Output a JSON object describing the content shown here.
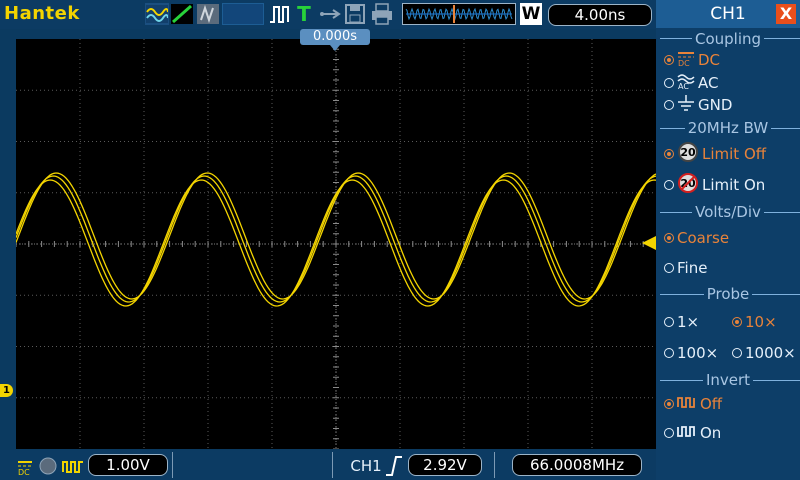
{
  "header": {
    "brand": "Hantek",
    "trigger_letter": "T",
    "time_mode": "W",
    "timebase": "4.00ns",
    "trigger_position": "0.000s"
  },
  "display": {
    "channel_marker": "1",
    "trace_color": "#f3d400",
    "grid_color": "#5a5a5a"
  },
  "footer": {
    "ch1_volts": "1.00V",
    "trigger_source": "CH1",
    "trigger_level": "2.92V",
    "frequency": "66.0008MHz"
  },
  "panel": {
    "title": "CH1",
    "close": "X",
    "coupling": {
      "title": "Coupling",
      "dc": "DC",
      "ac": "AC",
      "gnd": "GND"
    },
    "bw": {
      "title": "20MHz BW",
      "limit_off": "Limit Off",
      "limit_on": "Limit On",
      "badge": "20"
    },
    "volts": {
      "title": "Volts/Div",
      "coarse": "Coarse",
      "fine": "Fine"
    },
    "probe": {
      "title": "Probe",
      "x1": "1×",
      "x10": "10×",
      "x100": "100×",
      "x1000": "1000×"
    },
    "invert": {
      "title": "Invert",
      "off": "Off",
      "on": "On"
    }
  }
}
